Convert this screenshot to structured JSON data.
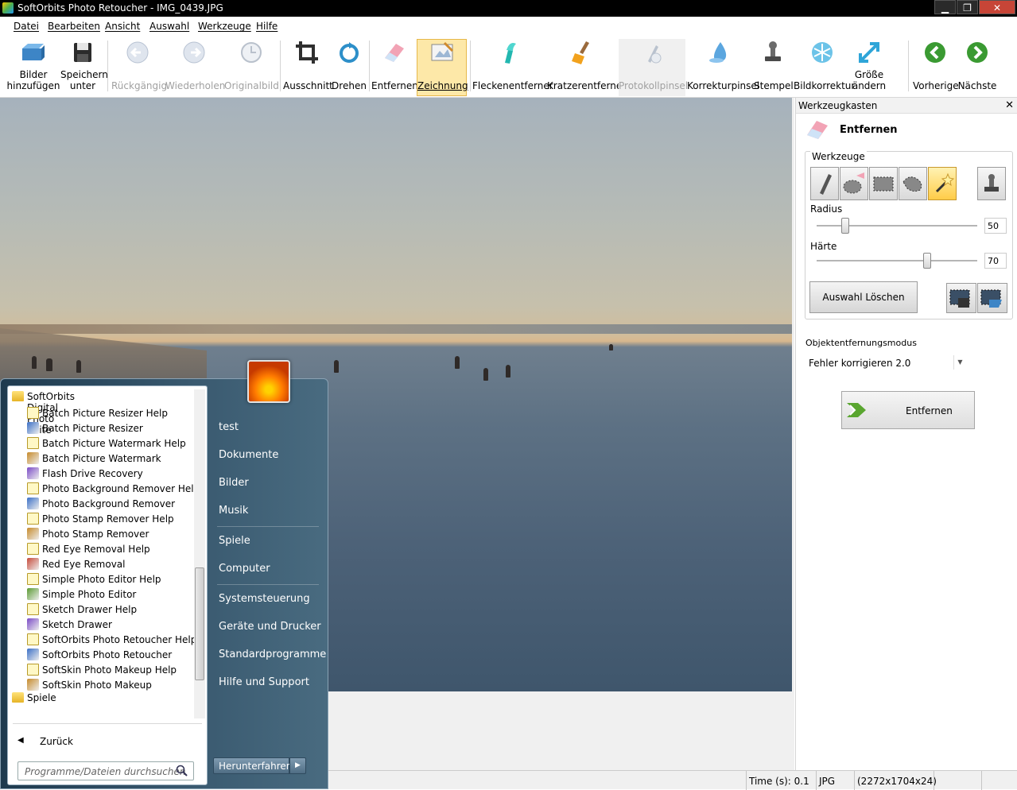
{
  "window": {
    "title": "SoftOrbits Photo Retoucher - IMG_0439.JPG",
    "minimize": "▁",
    "maximize": "❐",
    "close": "✕"
  },
  "menu": [
    "Datei",
    "Bearbeiten",
    "Ansicht",
    "Auswahl",
    "Werkzeuge",
    "Hilfe"
  ],
  "toolbar": {
    "add_images": [
      "Bilder",
      "hinzufügen"
    ],
    "save_as": [
      "Speichern",
      "unter"
    ],
    "undo": "Rückgängig",
    "redo": "Wiederholen",
    "original": "Originalbild",
    "crop": "Ausschnitt",
    "rotate": "Drehen",
    "remove": "Entfernen",
    "drawing": "Zeichnung",
    "spot_remover": "Fleckenentferner",
    "scratch_remover": "Kratzerentferner",
    "protocol_brush": "Protokollpinsel",
    "correction_brush": "Korrekturpinsel",
    "stamp": "Stempel",
    "image_correction": "Bildkorrektur",
    "resize": [
      "Größe",
      "ändern"
    ],
    "previous": "Vorherige",
    "next": "Nächste"
  },
  "toolbox": {
    "title": "Werkzeugkasten",
    "close": "✕",
    "section": "Entfernen",
    "tools_group": "Werkzeuge",
    "radius_label": "Radius",
    "radius_value": "50",
    "radius_level": 0.18,
    "hardness_label": "Härte",
    "hardness_value": "70",
    "hardness_level": 0.69,
    "clear_selection": "Auswahl Löschen",
    "mode_label": "Objektentfernungsmodus",
    "mode_value": "Fehler korrigieren 2.0",
    "remove_button": "Entfernen"
  },
  "status": {
    "time": "Time (s): 0.1",
    "format": "JPG",
    "dimensions": "(2272x1704x24)"
  },
  "startmenu": {
    "folder": "SoftOrbits Digital Photo Suite",
    "items": [
      {
        "label": "Batch Picture Resizer Help",
        "icon": "help-icon"
      },
      {
        "label": "Batch Picture Resizer",
        "icon": "app-icon"
      },
      {
        "label": "Batch Picture Watermark Help",
        "icon": "help-icon"
      },
      {
        "label": "Batch Picture Watermark",
        "icon": "app-icon"
      },
      {
        "label": "Flash Drive Recovery",
        "icon": "app-icon"
      },
      {
        "label": "Photo Background Remover Help",
        "icon": "help-icon"
      },
      {
        "label": "Photo Background Remover",
        "icon": "app-icon"
      },
      {
        "label": "Photo Stamp Remover Help",
        "icon": "help-icon"
      },
      {
        "label": "Photo Stamp Remover",
        "icon": "app-icon"
      },
      {
        "label": "Red Eye Removal Help",
        "icon": "help-icon"
      },
      {
        "label": "Red Eye Removal",
        "icon": "app-icon"
      },
      {
        "label": "Simple Photo Editor Help",
        "icon": "help-icon"
      },
      {
        "label": "Simple Photo Editor",
        "icon": "app-icon"
      },
      {
        "label": "Sketch Drawer Help",
        "icon": "help-icon"
      },
      {
        "label": "Sketch Drawer",
        "icon": "app-icon"
      },
      {
        "label": "SoftOrbits Photo Retoucher Help",
        "icon": "help-icon"
      },
      {
        "label": "SoftOrbits Photo Retoucher",
        "icon": "app-icon"
      },
      {
        "label": "SoftSkin Photo Makeup Help",
        "icon": "help-icon"
      },
      {
        "label": "SoftSkin Photo Makeup",
        "icon": "app-icon"
      }
    ],
    "games_folder": "Spiele",
    "back": "Zurück",
    "back_arrow": "◀",
    "search_placeholder": "Programme/Dateien durchsuchen",
    "right": [
      "test",
      "Dokumente",
      "Bilder",
      "Musik",
      "Spiele",
      "Computer",
      "Systemsteuerung",
      "Geräte und Drucker",
      "Standardprogramme",
      "Hilfe und Support"
    ],
    "shutdown": "Herunterfahren",
    "shutdown_arrow": "▶"
  }
}
